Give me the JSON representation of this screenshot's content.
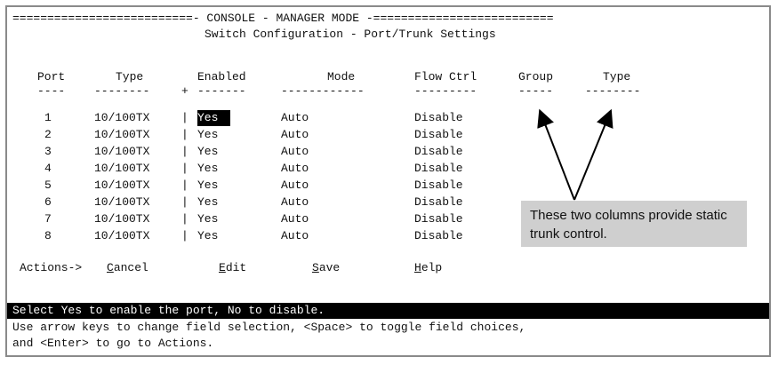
{
  "header": {
    "line1": "==========================- CONSOLE - MANAGER MODE -==========================",
    "title": "Switch Configuration - Port/Trunk Settings"
  },
  "columns": {
    "port": "Port",
    "type": "Type",
    "enabled": "Enabled",
    "mode": "Mode",
    "flow_ctrl": "Flow Ctrl",
    "group": "Group",
    "trunk_type": "Type"
  },
  "separators": {
    "port": "----",
    "type": "--------",
    "plus": "+",
    "enabled": "-------",
    "mode": "------------",
    "flow_ctrl": "---------",
    "group": "-----",
    "trunk_type": "--------"
  },
  "rows": [
    {
      "port": "1",
      "type": "10/100TX",
      "sep": "|",
      "enabled": "Yes",
      "mode": "Auto",
      "flow": "Disable"
    },
    {
      "port": "2",
      "type": "10/100TX",
      "sep": "|",
      "enabled": "Yes",
      "mode": "Auto",
      "flow": "Disable"
    },
    {
      "port": "3",
      "type": "10/100TX",
      "sep": "|",
      "enabled": "Yes",
      "mode": "Auto",
      "flow": "Disable"
    },
    {
      "port": "4",
      "type": "10/100TX",
      "sep": "|",
      "enabled": "Yes",
      "mode": "Auto",
      "flow": "Disable"
    },
    {
      "port": "5",
      "type": "10/100TX",
      "sep": "|",
      "enabled": "Yes",
      "mode": "Auto",
      "flow": "Disable"
    },
    {
      "port": "6",
      "type": "10/100TX",
      "sep": "|",
      "enabled": "Yes",
      "mode": "Auto",
      "flow": "Disable"
    },
    {
      "port": "7",
      "type": "10/100TX",
      "sep": "|",
      "enabled": "Yes",
      "mode": "Auto",
      "flow": "Disable"
    },
    {
      "port": "8",
      "type": "10/100TX",
      "sep": "|",
      "enabled": "Yes",
      "mode": "Auto",
      "flow": "Disable"
    }
  ],
  "actions": {
    "label": "Actions->",
    "cancel": "Cancel",
    "edit": "Edit",
    "save": "Save",
    "help": "Help"
  },
  "status": {
    "message": "Select Yes to enable the port, No to disable.",
    "help1": "Use arrow keys to change field selection, <Space> to toggle field choices,",
    "help2": "and <Enter> to go to Actions."
  },
  "callout": {
    "text": "These two columns provide static trunk control."
  }
}
